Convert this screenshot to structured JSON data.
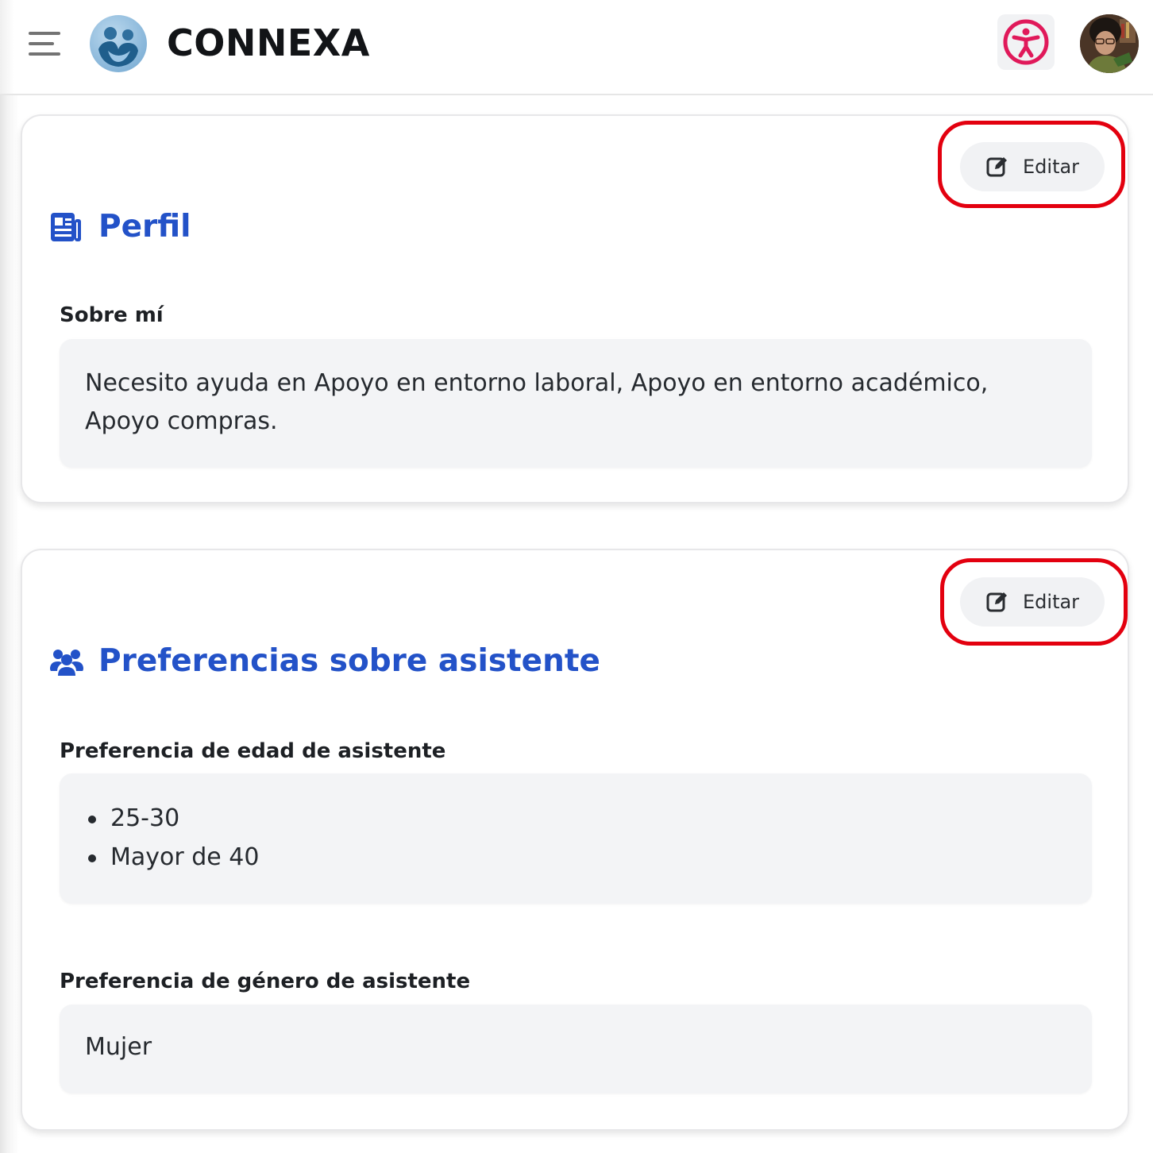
{
  "header": {
    "brand": "CONNEXA",
    "menu_icon": "hamburger-menu-icon",
    "logo_icon": "connexa-logo-icon",
    "accessibility_icon": "accessibility-icon",
    "colors": {
      "brand_text": "#121417",
      "accessibility": "#e0195a"
    }
  },
  "cards": {
    "profile": {
      "title": "Perfil",
      "title_icon": "newspaper-icon",
      "edit_label": "Editar",
      "edit_icon": "pen-to-square-icon",
      "about_label": "Sobre mí",
      "about_text": "Necesito ayuda en Apoyo en entorno laboral, Apoyo en entorno académico, Apoyo compras."
    },
    "preferences": {
      "title": "Preferencias sobre asistente",
      "title_icon": "users-icon",
      "edit_label": "Editar",
      "edit_icon": "pen-to-square-icon",
      "age_label": "Preferencia de edad de asistente",
      "age_values": [
        "25-30",
        "Mayor de 40"
      ],
      "gender_label": "Preferencia de género de asistente",
      "gender_value": "Mujer"
    }
  },
  "colors": {
    "accent": "#2352c8",
    "highlight": "#e3000f",
    "field_bg": "#f3f4f6"
  }
}
